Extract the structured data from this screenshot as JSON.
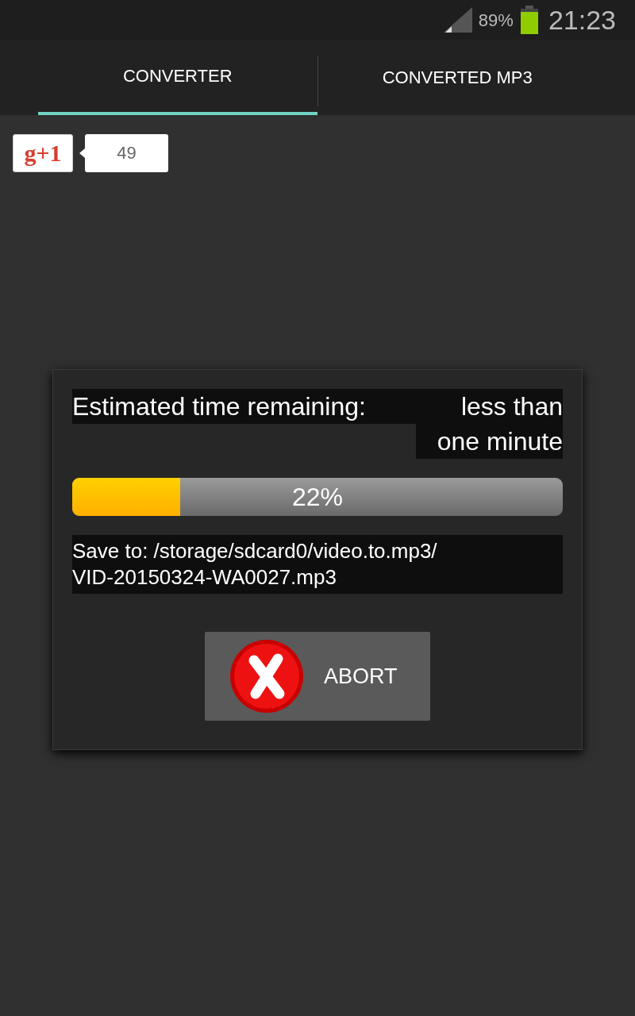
{
  "status_bar": {
    "battery": "89%",
    "time": "21:23"
  },
  "tabs": [
    {
      "label": "CONVERTER",
      "selected": true
    },
    {
      "label": "CONVERTED MP3",
      "selected": false
    }
  ],
  "plus_one": {
    "label": "g+1",
    "count": "49"
  },
  "dialog": {
    "eta_label": "Estimated time remaining:",
    "eta_value": "less than one minute",
    "progress": {
      "level": 0.22,
      "reading": "22%"
    },
    "save_to": "Save to: /storage/sdcard0/video.to.mp3/\nVID-20150324-WA0027.mp3",
    "abort": "ABORT"
  }
}
